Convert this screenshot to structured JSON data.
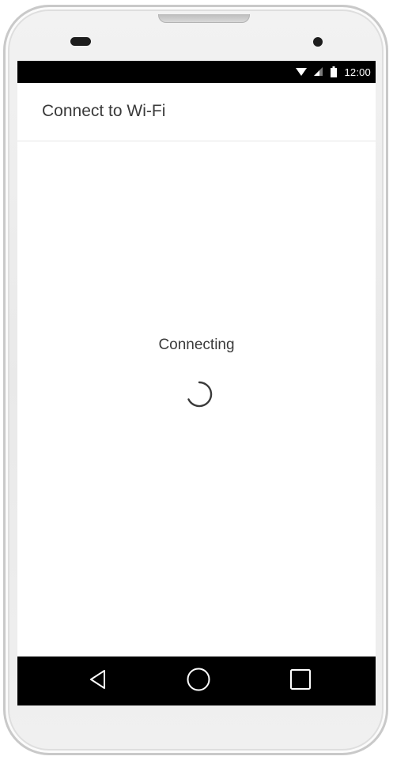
{
  "status_bar": {
    "time": "12:00",
    "icons": [
      "wifi-icon",
      "cellular-signal-icon",
      "battery-icon"
    ]
  },
  "app_bar": {
    "title": "Connect to Wi-Fi"
  },
  "content": {
    "status_text": "Connecting",
    "spinner": "loading-spinner-icon"
  },
  "nav_bar": {
    "buttons": [
      "back-icon",
      "home-icon",
      "recents-icon"
    ]
  },
  "colors": {
    "status_bar_bg": "#000000",
    "nav_bar_bg": "#000000",
    "screen_bg": "#ffffff",
    "text": "#3a3a3a"
  }
}
